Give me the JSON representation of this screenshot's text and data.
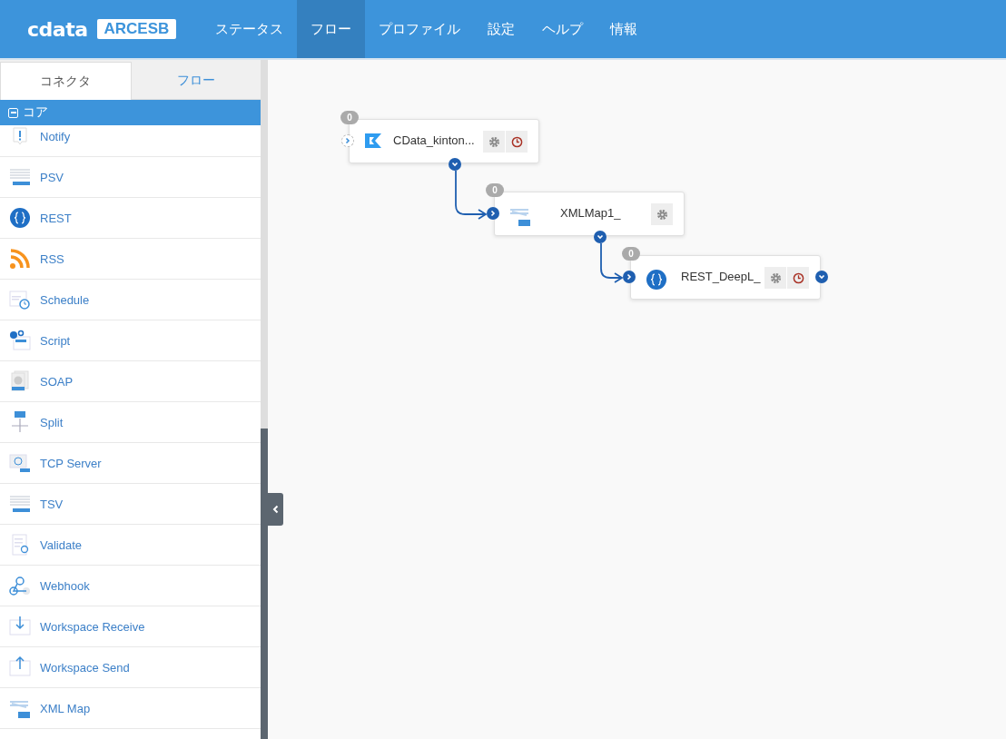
{
  "header": {
    "logo": "cdata",
    "product": "ARCESB",
    "nav": [
      {
        "label": "ステータス",
        "selected": false
      },
      {
        "label": "フロー",
        "selected": true
      },
      {
        "label": "プロファイル",
        "selected": false
      },
      {
        "label": "設定",
        "selected": false
      },
      {
        "label": "ヘルプ",
        "selected": false
      },
      {
        "label": "情報",
        "selected": false
      }
    ]
  },
  "sidebar": {
    "tabs": [
      {
        "label": "コネクタ",
        "selected": true
      },
      {
        "label": "フロー",
        "selected": false
      }
    ],
    "category": {
      "label": "コア",
      "expanded": true
    },
    "items": [
      {
        "label": "Notify"
      },
      {
        "label": "PSV"
      },
      {
        "label": "REST"
      },
      {
        "label": "RSS"
      },
      {
        "label": "Schedule"
      },
      {
        "label": "Script"
      },
      {
        "label": "SOAP"
      },
      {
        "label": "Split"
      },
      {
        "label": "TCP Server"
      },
      {
        "label": "TSV"
      },
      {
        "label": "Validate"
      },
      {
        "label": "Webhook"
      },
      {
        "label": "Workspace Receive"
      },
      {
        "label": "Workspace Send"
      },
      {
        "label": "XML Map"
      }
    ]
  },
  "flow": {
    "nodes": [
      {
        "name": "CData_kinton...",
        "count": "0"
      },
      {
        "name": "XMLMap1_",
        "count": "0"
      },
      {
        "name": "REST_DeepL_",
        "count": "0"
      }
    ]
  }
}
